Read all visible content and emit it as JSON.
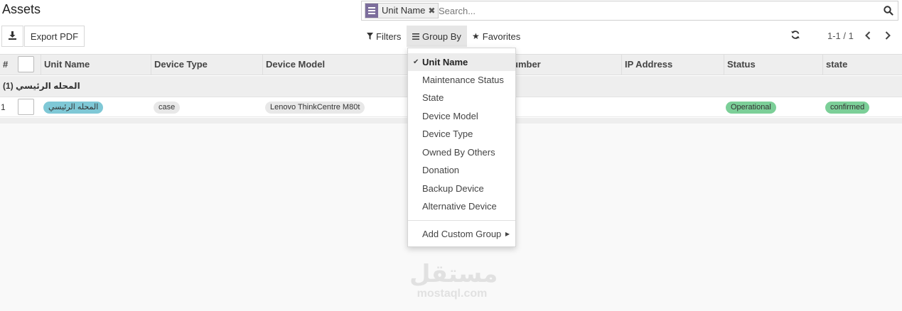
{
  "page": {
    "title": "Assets"
  },
  "search": {
    "facet_label": "Unit Name",
    "facet_remove": "✖",
    "placeholder": "Search...",
    "icon": "search-icon"
  },
  "toolbar": {
    "download_icon": "download-icon",
    "export_label": "Export PDF"
  },
  "filters_bar": {
    "filters_label": "Filters",
    "groupby_label": "Group By",
    "favorites_label": "Favorites"
  },
  "pager": {
    "value": "1-1 / 1",
    "refresh_icon": "refresh-icon"
  },
  "table": {
    "row_number_header": "#",
    "columns": [
      "Unit Name",
      "Device Type",
      "Device Model",
      "umber",
      "IP Address",
      "Status",
      "state"
    ],
    "group": {
      "label": "المحله الرئيسي (1)"
    },
    "rows": [
      {
        "number": "1",
        "unit_name": "المحله الرئيسي",
        "device_type": "case",
        "device_model": "Lenovo ThinkCentre M80t",
        "status": "Operational",
        "state": "confirmed"
      }
    ]
  },
  "groupby_menu": {
    "items": [
      {
        "label": "Unit Name",
        "selected": true
      },
      {
        "label": "Maintenance Status",
        "selected": false
      },
      {
        "label": "State",
        "selected": false
      },
      {
        "label": "Device Model",
        "selected": false
      },
      {
        "label": "Device Type",
        "selected": false
      },
      {
        "label": "Owned By Others",
        "selected": false
      },
      {
        "label": "Donation",
        "selected": false
      },
      {
        "label": "Backup Device",
        "selected": false
      },
      {
        "label": "Alternative Device",
        "selected": false
      }
    ],
    "custom_label": "Add Custom Group"
  },
  "watermark": {
    "arabic": "مستقل",
    "latin": "mostaql.com"
  },
  "colors": {
    "accent_purple": "#7c6d9c",
    "unit_tag": "#7fc8d6",
    "neutral_tag": "#e8e8e8",
    "status_green": "#7ccf98",
    "header_bg": "#eeeeee"
  }
}
